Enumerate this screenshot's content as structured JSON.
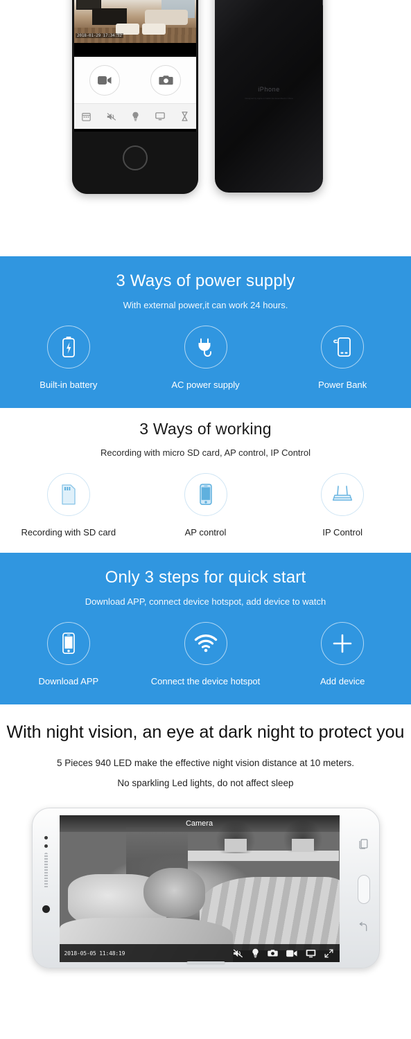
{
  "hero": {
    "front_phone": {
      "timestamp": "2018-01-29 17:34:52",
      "record_button": "record-video",
      "snapshot_button": "take-photo",
      "toolbar": [
        {
          "name": "playback-icon",
          "label": "Playback"
        },
        {
          "name": "mute-speaker-icon",
          "label": "Mute"
        },
        {
          "name": "lightbulb-icon",
          "label": "Light"
        },
        {
          "name": "monitor-icon",
          "label": "Screen"
        },
        {
          "name": "hourglass-icon",
          "label": "Timer"
        }
      ]
    },
    "back_phone": {
      "brand_word": "iPhone",
      "fine_print_line1": "Designed by Apple in California   Assembled in China",
      "fine_print_line2": "Model A1784  FCC ID BCG-E3091A  IC 579C-E3091A"
    }
  },
  "sections": [
    {
      "id": "power-supply",
      "theme": "blue",
      "title": "3 Ways of power supply",
      "subtitle": "With external power,it can work 24 hours.",
      "items": [
        {
          "icon": "battery-icon",
          "label": "Built-in battery"
        },
        {
          "icon": "power-plug-icon",
          "label": "AC power supply"
        },
        {
          "icon": "power-bank-icon",
          "label": "Power Bank"
        }
      ]
    },
    {
      "id": "ways-of-working",
      "theme": "white",
      "title": "3 Ways of working",
      "subtitle": "Recording with micro SD card,  AP control,  IP Control",
      "items": [
        {
          "icon": "sd-card-icon",
          "label": "Recording with SD card"
        },
        {
          "icon": "smartphone-icon",
          "label": "AP control"
        },
        {
          "icon": "router-icon",
          "label": "IP Control"
        }
      ]
    },
    {
      "id": "quick-start",
      "theme": "blue",
      "title": "Only 3 steps for quick start",
      "subtitle": "Download APP, connect device hotspot, add device to watch",
      "items": [
        {
          "icon": "smartphone-icon",
          "label": "Download APP"
        },
        {
          "icon": "wifi-icon",
          "label": "Connect the device hotspot"
        },
        {
          "icon": "plus-icon",
          "label": "Add device"
        }
      ]
    }
  ],
  "night_vision": {
    "title": "With night vision, an eye at dark night to protect you",
    "line1": "5 Pieces 940 LED make the effective night vision distance at 10 meters.",
    "line2": "No sparkling Led lights, do not affect sleep",
    "phone": {
      "screen_title": "Camera",
      "timestamp": "2018-05-05 11:48:19",
      "toolbar": [
        {
          "name": "mute-speaker-icon",
          "label": "Mute"
        },
        {
          "name": "lightbulb-icon",
          "label": "Light"
        },
        {
          "name": "photo-camera-icon",
          "label": "Snapshot"
        },
        {
          "name": "video-camera-icon",
          "label": "Record"
        },
        {
          "name": "monitor-icon",
          "label": "Screen"
        },
        {
          "name": "fullscreen-icon",
          "label": "Fullscreen"
        }
      ]
    }
  },
  "colors": {
    "brand_blue": "#3096e0",
    "white": "#ffffff",
    "icon_light_blue": "#8ec7e8",
    "text_dark": "#1a1a1a"
  }
}
